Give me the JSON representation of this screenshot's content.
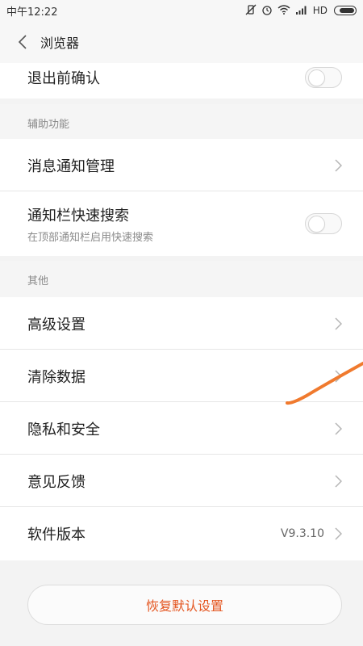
{
  "status_bar": {
    "time": "中午12:22",
    "network_label": "HD"
  },
  "header": {
    "title": "浏览器"
  },
  "top_group": {
    "item_label": "退出前确认"
  },
  "sections": {
    "accessibility_title": "辅助功能",
    "other_title": "其他"
  },
  "accessibility": {
    "notification_manage": "消息通知管理",
    "quick_search": "通知栏快速搜索",
    "quick_search_sub": "在顶部通知栏启用快速搜索"
  },
  "other": {
    "advanced": "高级设置",
    "clear_data": "清除数据",
    "privacy": "隐私和安全",
    "feedback": "意见反馈",
    "version_label": "软件版本",
    "version_value": "V9.3.10"
  },
  "footer": {
    "reset_label": "恢复默认设置"
  },
  "colors": {
    "accent": "#e4551f",
    "annotation": "#f07a2e"
  }
}
